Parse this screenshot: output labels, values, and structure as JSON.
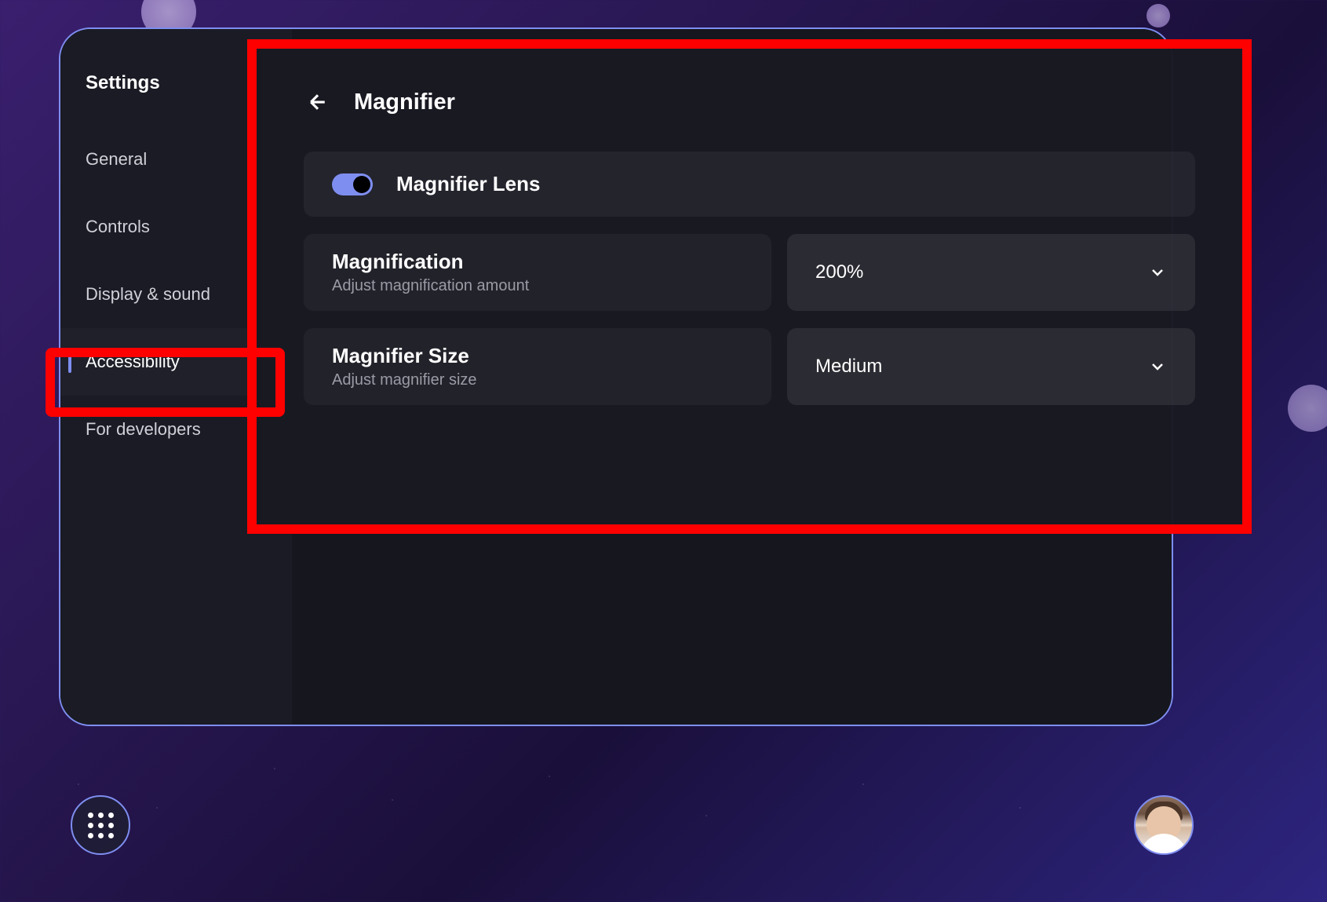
{
  "sidebar": {
    "title": "Settings",
    "items": [
      {
        "label": "General"
      },
      {
        "label": "Controls"
      },
      {
        "label": "Display & sound"
      },
      {
        "label": "Accessibility"
      },
      {
        "label": "For developers"
      }
    ],
    "active_index": 3
  },
  "panel": {
    "title": "Magnifier",
    "toggle": {
      "label": "Magnifier Lens",
      "on": true
    },
    "magnification": {
      "title": "Magnification",
      "subtitle": "Adjust magnification amount",
      "value": "200%"
    },
    "size": {
      "title": "Magnifier Size",
      "subtitle": "Adjust magnifier size",
      "value": "Medium"
    }
  },
  "highlights": {
    "accessibility_sidebar": true,
    "magnifier_panel": true
  },
  "colors": {
    "accent": "#7e8ef0",
    "highlight": "#ff0000"
  }
}
